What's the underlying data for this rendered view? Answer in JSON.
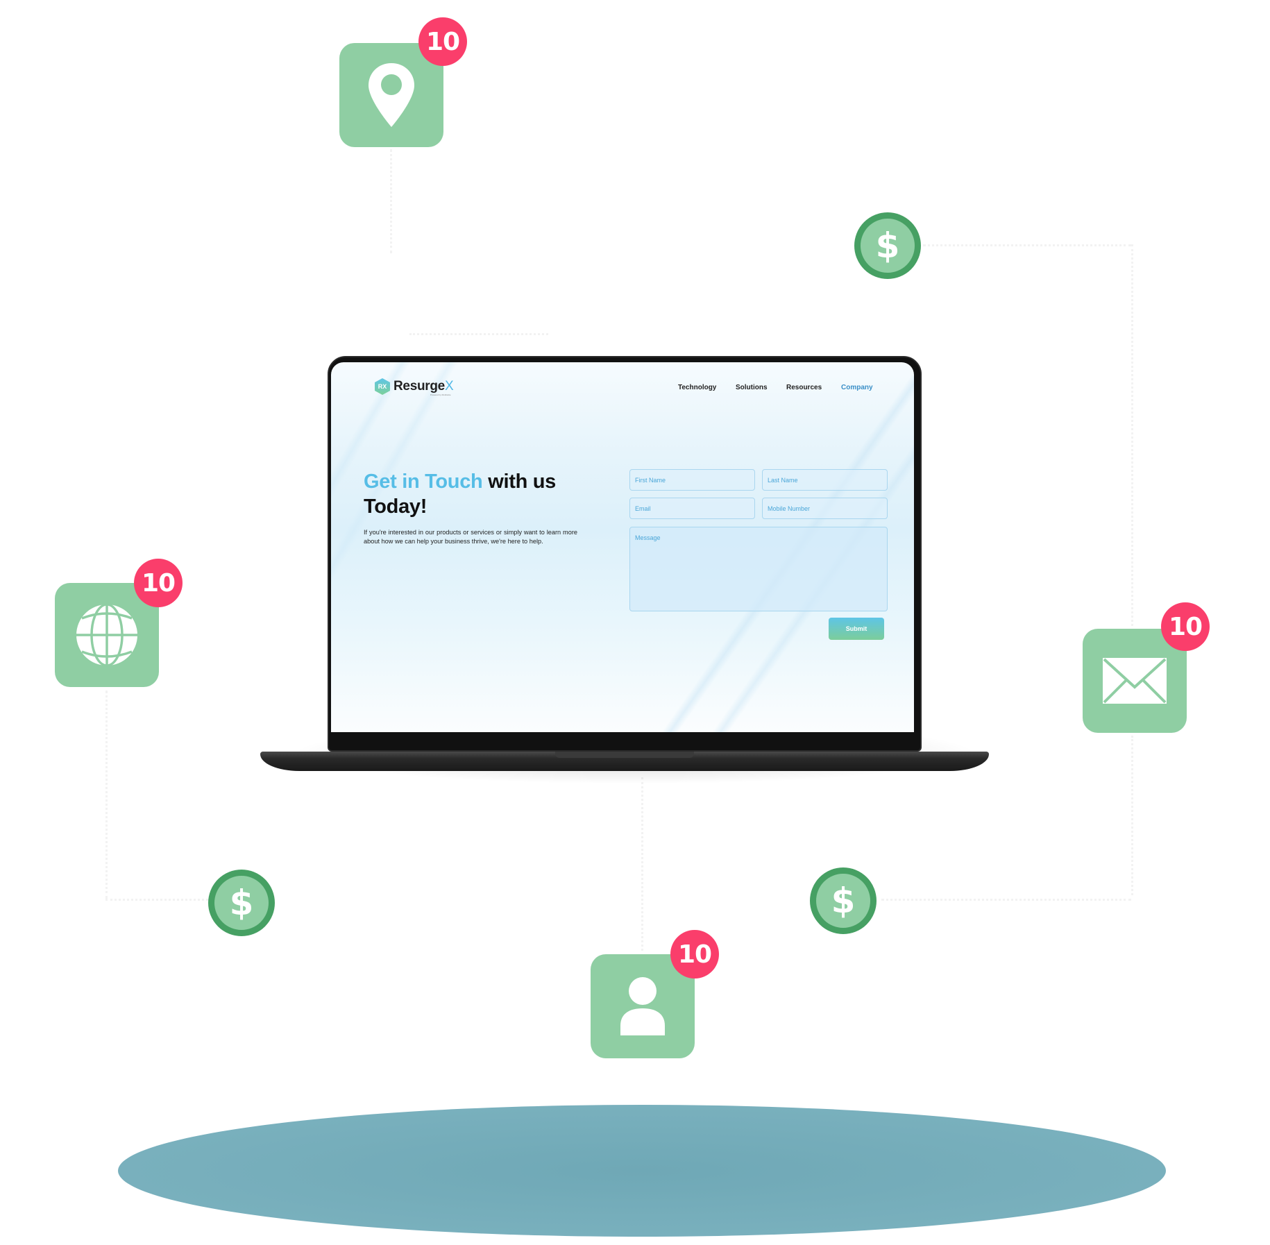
{
  "colors": {
    "tile_green": "#8fcea3",
    "coin_ring": "#46a063",
    "badge_red": "#fa3e6b",
    "accent_blue": "#56bde6",
    "nav_active": "#3a8fc7",
    "ground": "#74aab7"
  },
  "floating_icons": [
    {
      "icon": "location-pin-icon",
      "badge": "10"
    },
    {
      "icon": "globe-icon",
      "badge": "10"
    },
    {
      "icon": "mail-icon",
      "badge": "10"
    },
    {
      "icon": "person-icon",
      "badge": "10"
    }
  ],
  "coins": [
    {
      "icon": "dollar-icon",
      "symbol": "$"
    },
    {
      "icon": "dollar-icon",
      "symbol": "$"
    },
    {
      "icon": "dollar-icon",
      "symbol": "$"
    }
  ],
  "website": {
    "logo": {
      "mark": "RX",
      "name": "Resurge",
      "name_suffix": "X",
      "tagline": "Powered by Mobiloitte"
    },
    "nav": [
      {
        "label": "Technology",
        "active": false
      },
      {
        "label": "Solutions",
        "active": false
      },
      {
        "label": "Resources",
        "active": false
      },
      {
        "label": "Company",
        "active": true
      }
    ],
    "hero": {
      "title_accent": "Get in Touch",
      "title_rest": " with us",
      "title_line2": "Today!",
      "description": "If you're interested in our products or services or simply want to learn more about how we can help your business thrive, we're here to help."
    },
    "form": {
      "first_name_placeholder": "First Name",
      "last_name_placeholder": "Last Name",
      "email_placeholder": "Email",
      "mobile_placeholder": "Mobile Number",
      "message_placeholder": "Message",
      "submit_label": "Submit"
    }
  }
}
